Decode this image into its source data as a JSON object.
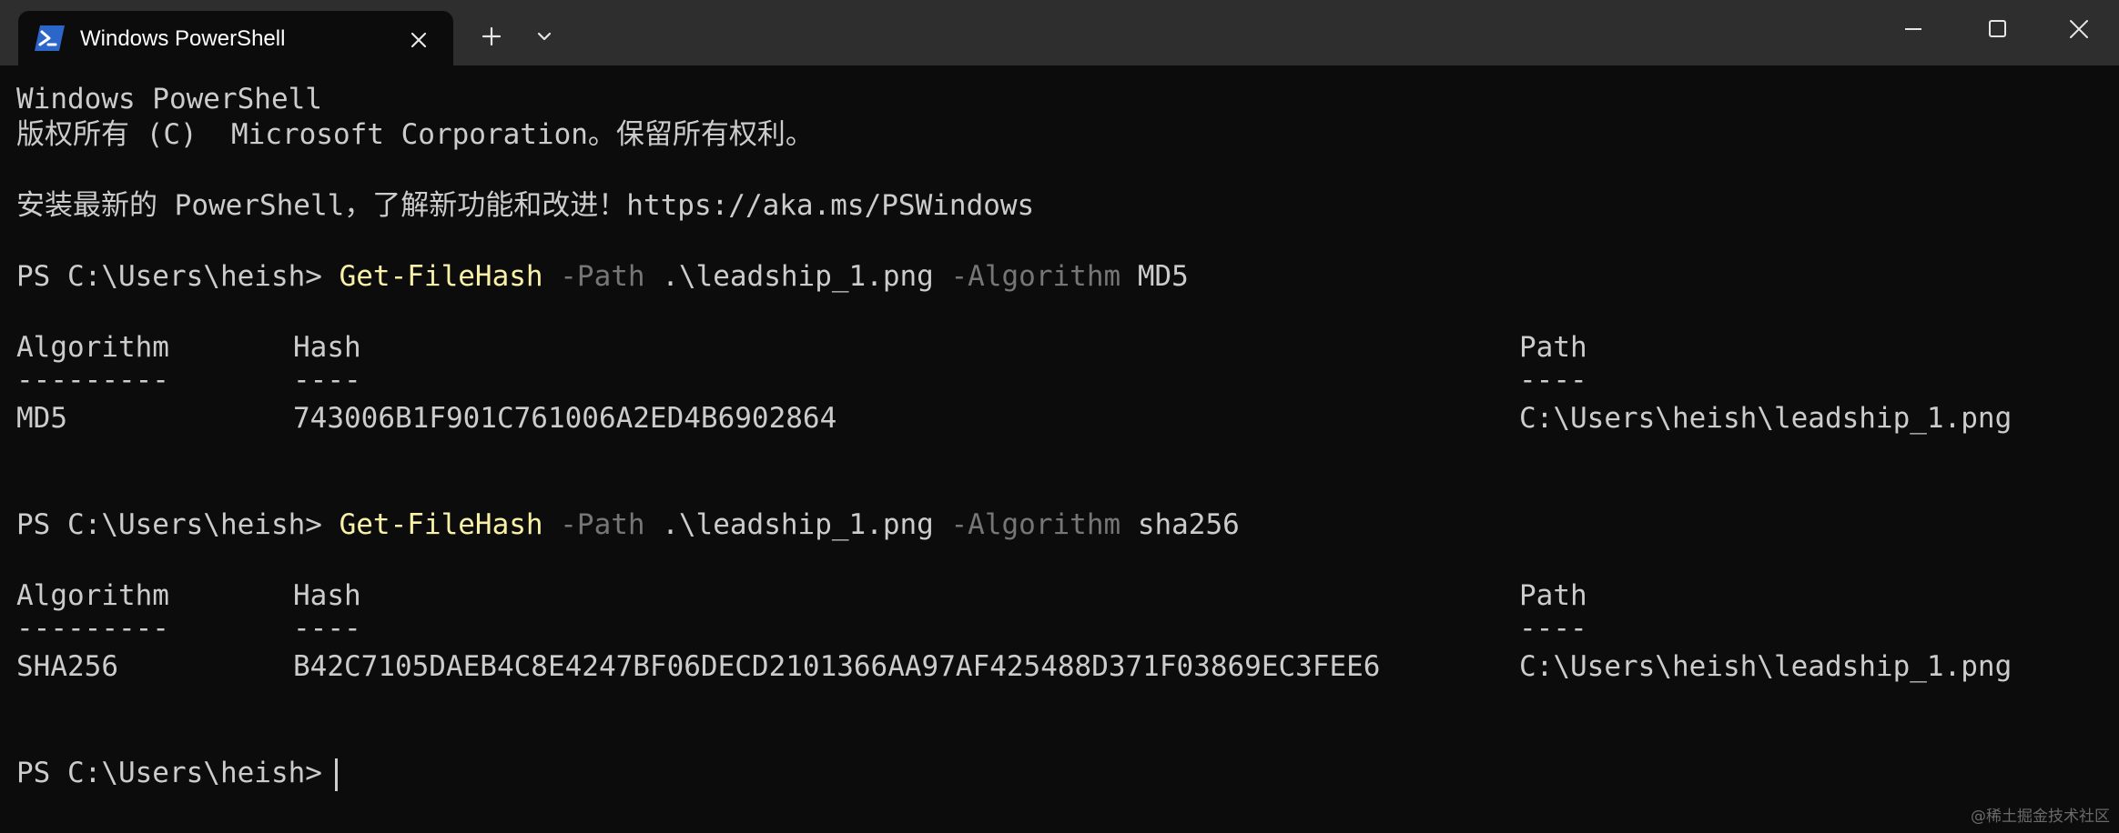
{
  "tab": {
    "title": "Windows PowerShell",
    "icon": "powershell-icon",
    "close_icon": "close-icon"
  },
  "tabstrip": {
    "new_tab_icon": "plus-icon",
    "dropdown_icon": "chevron-down-icon"
  },
  "window_controls": {
    "minimize_icon": "minimize-icon",
    "maximize_icon": "maximize-icon",
    "close_icon": "close-icon"
  },
  "terminal": {
    "banner": {
      "line1": "Windows PowerShell",
      "line2": "版权所有 (C)  Microsoft Corporation。保留所有权利。",
      "line3": "安装最新的 PowerShell，了解新功能和改进！https://aka.ms/PSWindows"
    },
    "commands": [
      {
        "prompt": "PS C:\\Users\\heish> ",
        "cmdlet": "Get-FileHash",
        "param1": " -Path",
        "value1": " .\\leadship_1.png",
        "param2": " -Algorithm",
        "value2": " MD5",
        "output": {
          "headers": [
            "Algorithm",
            "Hash",
            "Path"
          ],
          "separators": [
            "---------",
            "----",
            "----"
          ],
          "row": [
            "MD5",
            "743006B1F901C761006A2ED4B6902864",
            "C:\\Users\\heish\\leadship_1.png"
          ]
        }
      },
      {
        "prompt": "PS C:\\Users\\heish> ",
        "cmdlet": "Get-FileHash",
        "param1": " -Path",
        "value1": " .\\leadship_1.png",
        "param2": " -Algorithm",
        "value2": " sha256",
        "output": {
          "headers": [
            "Algorithm",
            "Hash",
            "Path"
          ],
          "separators": [
            "---------",
            "----",
            "----"
          ],
          "row": [
            "SHA256",
            "B42C7105DAEB4C8E4247BF06DECD2101366AA97AF425488D371F03869EC3FEE6",
            "C:\\Users\\heish\\leadship_1.png"
          ]
        }
      }
    ],
    "final_prompt": "PS C:\\Users\\heish>"
  },
  "colors": {
    "background": "#0c0c0c",
    "titlebar": "#2e2e2e",
    "foreground": "#cccccc",
    "cmdlet": "#f9f1a5",
    "parameter": "#767676"
  },
  "watermark": "@稀土掘金技术社区"
}
